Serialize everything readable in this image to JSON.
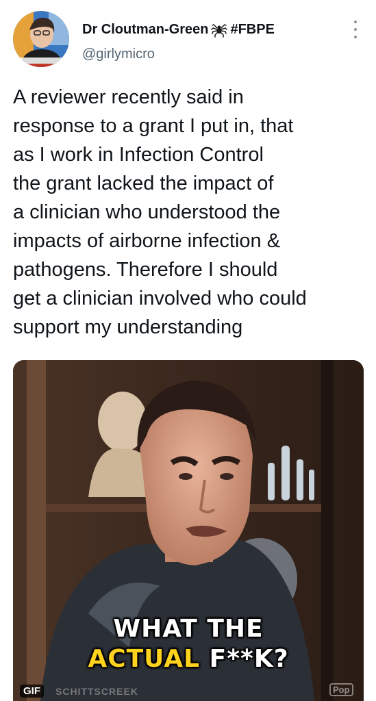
{
  "author": {
    "display_name": "Dr Cloutman-Green",
    "emoji_icon": "spider-icon",
    "hashtag": "#FBPE",
    "handle": "@girlymicro",
    "avatar_icon": "profile-photo"
  },
  "menu": {
    "icon": "more-vertical-icon"
  },
  "tweet": {
    "lines": [
      "A reviewer recently said in",
      "response to a grant I put in, that",
      "as I work in Infection Control",
      "the grant lacked the impact of",
      "a clinician who understood the",
      "impacts of airborne infection &",
      "pathogens. Therefore I should",
      "get a clinician involved who could",
      "support my understanding"
    ]
  },
  "media": {
    "caption_line1": "WHAT THE",
    "caption_line2_part1": "ACTUAL",
    "caption_line2_part2": "F**K?",
    "gif_badge": "GIF",
    "watermark": "SCHITTSCREEK",
    "network_logo": "Pop"
  }
}
